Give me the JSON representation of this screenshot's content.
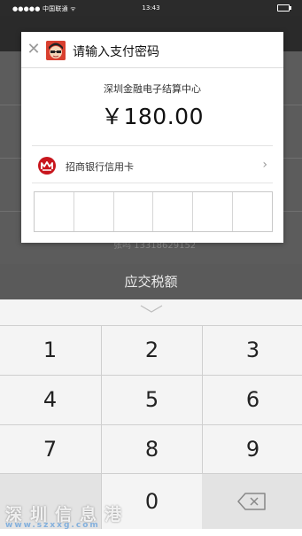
{
  "status_bar": {
    "carrier": "●●●●● 中国联通 ᯤ",
    "time": "13:43"
  },
  "background": {
    "tax_label": "应交税额",
    "partial_text": "张鸣 13318629152"
  },
  "dialog": {
    "title": "请输入支付密码",
    "merchant": "深圳金融电子结算中心",
    "amount": "￥180.00",
    "bank": "招商银行信用卡",
    "close_symbol": "✕",
    "chevron": "›"
  },
  "keypad": {
    "keys": [
      "1",
      "2",
      "3",
      "4",
      "5",
      "6",
      "7",
      "8",
      "9",
      "0"
    ],
    "delete_icon": "backspace-icon"
  },
  "watermark": {
    "line1": "深圳信息港",
    "line2": "www.szxxg.com"
  },
  "colors": {
    "bank_red": "#c8161d",
    "avatar_red": "#d94030",
    "keypad_bg": "#f4f4f4"
  }
}
